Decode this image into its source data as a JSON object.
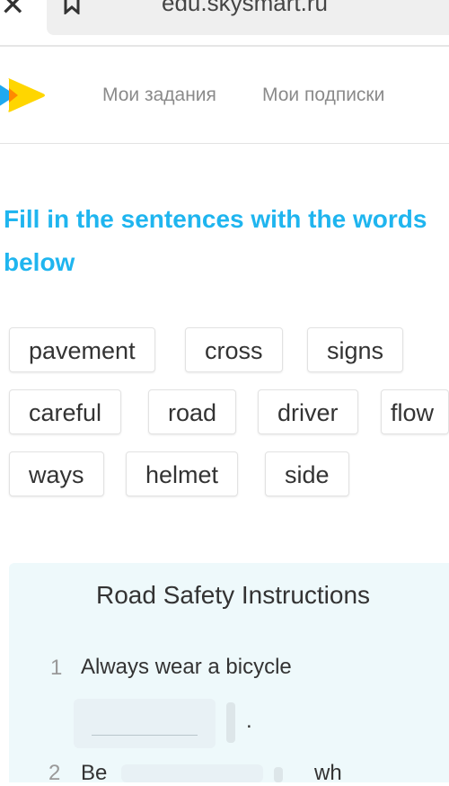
{
  "browser": {
    "url": "edu.skysmart.ru",
    "close_icon": "close-icon",
    "bookmark_icon": "bookmark-icon"
  },
  "nav": {
    "links": [
      {
        "label": "Мои задания"
      },
      {
        "label": "Мои подписки"
      }
    ]
  },
  "colors": {
    "title": "#1fb5ef",
    "logo_blue": "#1fa9f0",
    "logo_yellow": "#ffd600",
    "logo_orange": "#ff8a00"
  },
  "task": {
    "title": "Fill in the sentences with the words below"
  },
  "words": [
    "pavement",
    "cross",
    "signs",
    "careful",
    "road",
    "driver",
    "flow",
    "ways",
    "helmet",
    "side"
  ],
  "exercise": {
    "title": "Road Safety Instructions",
    "items": [
      {
        "number": "1",
        "text": "Always wear a bicycle",
        "end": "."
      },
      {
        "number": "2",
        "text": "Be",
        "after": "wh"
      }
    ]
  }
}
